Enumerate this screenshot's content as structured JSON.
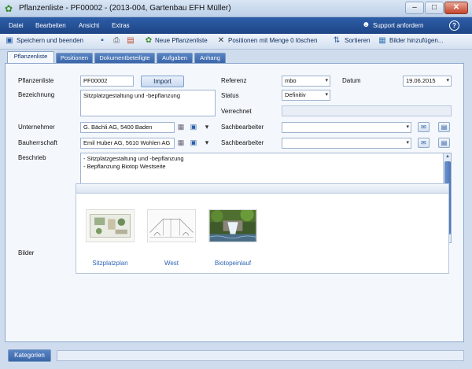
{
  "window": {
    "title": "Pflanzenliste - PF00002 - (2013-004, Gartenbau EFH Müller)",
    "minimize": "–",
    "maximize": "□",
    "close": "✕"
  },
  "menu": {
    "items": [
      "Datei",
      "Bearbeiten",
      "Ansicht",
      "Extras"
    ],
    "support": "Support anfordern"
  },
  "toolbar": {
    "save_close": "Speichern und beenden",
    "new_list": "Neue Pflanzenliste",
    "delete_zero": "Positionen mit Menge 0 löschen",
    "sort": "Sortieren",
    "add_images": "Bilder hinzufügen..."
  },
  "tabs": [
    "Pflanzenliste",
    "Positionen",
    "Dokumentbeteiligte",
    "Aufgaben",
    "Anhang"
  ],
  "form": {
    "pflanzenliste_label": "Pflanzenliste",
    "pflanzenliste_value": "PF00002",
    "import_label": "Import",
    "bezeichnung_label": "Bezeichnung",
    "bezeichnung_value": "Sitzplatzgestaltung und -bepflanzung",
    "referenz_label": "Referenz",
    "referenz_value": "mbo",
    "datum_label": "Datum",
    "datum_value": "19.06.2015",
    "status_label": "Status",
    "status_value": "Definitiv",
    "verrechnet_label": "Verrechnet",
    "unternehmer_label": "Unternehmer",
    "unternehmer_value": "G. Bächli AG, 5400 Baden",
    "bauherrschaft_label": "Bauherrschaft",
    "bauherrschaft_value": "Emil Huber AG, 5610 Wohlen AG",
    "sachbearbeiter_label": "Sachbearbeiter",
    "sachbearbeiter2_label": "Sachbearbeiter",
    "beschrieb_label": "Beschrieb",
    "beschrieb_lines": [
      "- Sitzplatzgestaltung und -bepflanzung",
      "- Bepflanzung Biotop Westseite"
    ],
    "bilder_label": "Bilder"
  },
  "images": [
    {
      "caption": "Sitzplatzplan"
    },
    {
      "caption": "West"
    },
    {
      "caption": "Biotopeinlauf"
    }
  ],
  "bottom": {
    "kategorien": "Kategorien"
  }
}
